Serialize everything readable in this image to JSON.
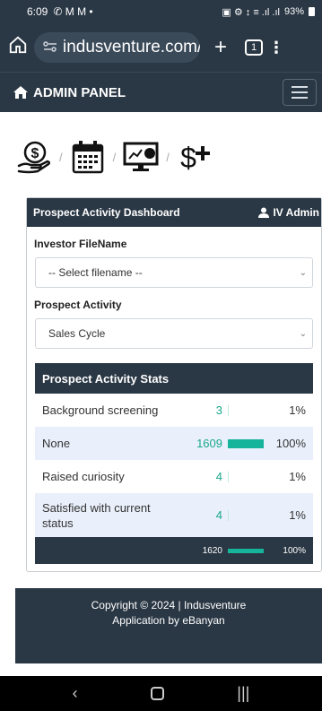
{
  "status_bar": {
    "time": "6:09",
    "left_icons": "✆ M M •",
    "signal_icons": "▣ ⚙ ↕ ≡ .ıl .ıl",
    "battery": "93%"
  },
  "browser": {
    "url": "indusventure.com/",
    "tab_count": "1"
  },
  "navbar": {
    "brand": "ADMIN PANEL"
  },
  "icon_crumbs": [
    "dollar-hand-icon",
    "calendar-icon",
    "dashboard-monitor-icon",
    "dollar-plus-icon"
  ],
  "card": {
    "title": "Prospect Activity Dashboard",
    "user": "IV Admin",
    "investor_label": "Investor FileName",
    "investor_select": "-- Select filename --",
    "activity_label": "Prospect Activity",
    "activity_select": "Sales Cycle"
  },
  "stats": {
    "title": "Prospect Activity Stats",
    "rows": [
      {
        "name": "Background screening",
        "count": "3",
        "pct": "1%",
        "fraction": 0.0
      },
      {
        "name": "None",
        "count": "1609",
        "pct": "100%",
        "fraction": 1.0
      },
      {
        "name": "Raised curiosity",
        "count": "4",
        "pct": "1%",
        "fraction": 0.0
      },
      {
        "name": "Satisfied with current status",
        "count": "4",
        "pct": "1%",
        "fraction": 0.0
      }
    ],
    "total": {
      "count": "1620",
      "pct": "100%",
      "fraction": 1.0
    }
  },
  "footer": {
    "line1": "Copyright © 2024 | Indusventure",
    "line2": "Application by eBanyan"
  },
  "colors": {
    "header": "#2a3744",
    "accent": "#16b49a",
    "row_alt": "#eaf0fb"
  }
}
